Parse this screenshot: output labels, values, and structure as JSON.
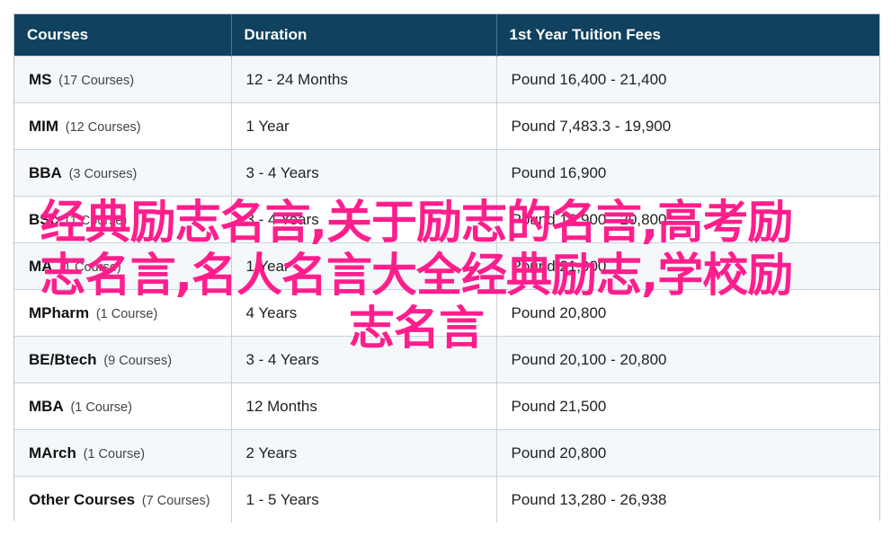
{
  "headers": [
    "Courses",
    "Duration",
    "1st Year Tuition Fees"
  ],
  "rows": [
    {
      "name": "MS",
      "count": "(17 Courses)",
      "duration": "12 - 24 Months",
      "fees": "Pound 16,400 - 21,400"
    },
    {
      "name": "MIM",
      "count": "(12 Courses)",
      "duration": "1 Year",
      "fees": "Pound 7,483.3 - 19,900"
    },
    {
      "name": "BBA",
      "count": "(3 Courses)",
      "duration": "3 - 4 Years",
      "fees": "Pound 16,900"
    },
    {
      "name": "BSc",
      "count": "(1 Course)",
      "duration": "3 - 4 Years",
      "fees": "Pound 16,900 - 20,800"
    },
    {
      "name": "MA",
      "count": "(1 Course)",
      "duration": "1 Year",
      "fees": "Pound 21,900"
    },
    {
      "name": "MPharm",
      "count": "(1 Course)",
      "duration": "4 Years",
      "fees": "Pound 20,800"
    },
    {
      "name": "BE/Btech",
      "count": "(9 Courses)",
      "duration": "3 - 4 Years",
      "fees": "Pound 20,100 - 20,800"
    },
    {
      "name": "MBA",
      "count": "(1 Course)",
      "duration": "12 Months",
      "fees": "Pound 21,500"
    },
    {
      "name": "MArch",
      "count": "(1 Course)",
      "duration": "2 Years",
      "fees": "Pound 20,800"
    },
    {
      "name": "Other Courses",
      "count": "(7 Courses)",
      "duration": "1 - 5 Years",
      "fees": "Pound 13,280 - 26,938"
    }
  ],
  "overlay_text": "经典励志名言,关于励志的名言,高考励志名言,名人名言大全经典励志,学校励志名言",
  "colors": {
    "header_bg": "#10415f",
    "header_text": "#ffffff",
    "row_alt_bg": "#f4f8fb",
    "overlay_text": "#ff1e8c"
  }
}
